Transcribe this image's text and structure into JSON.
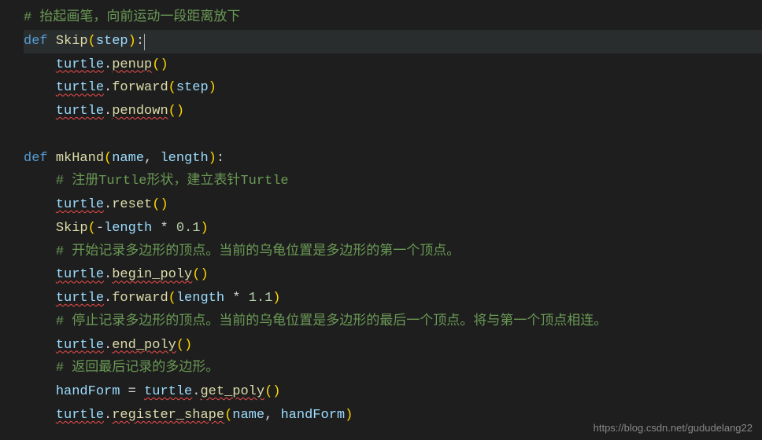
{
  "lines": {
    "l1": "# 抬起画笔，向前运动一段距离放下",
    "l2_def": "def ",
    "l2_func": "Skip",
    "l2_paren_open": "(",
    "l2_param": "step",
    "l2_paren_close": ")",
    "l2_colon": ":",
    "l3_indent": "    ",
    "l3_obj": "turtle",
    "l3_dot": ".",
    "l3_method": "penup",
    "l3_parens": "()",
    "l4_indent": "    ",
    "l4_obj": "turtle",
    "l4_dot": ".",
    "l4_method": "forward",
    "l4_paren_open": "(",
    "l4_arg": "step",
    "l4_paren_close": ")",
    "l5_indent": "    ",
    "l5_obj": "turtle",
    "l5_dot": ".",
    "l5_method": "pendown",
    "l5_parens": "()",
    "l7_def": "def ",
    "l7_func": "mkHand",
    "l7_paren_open": "(",
    "l7_param1": "name",
    "l7_comma": ", ",
    "l7_param2": "length",
    "l7_paren_close": ")",
    "l7_colon": ":",
    "l8_indent": "    ",
    "l8_comment": "# 注册Turtle形状，建立表针Turtle",
    "l9_indent": "    ",
    "l9_obj": "turtle",
    "l9_dot": ".",
    "l9_method": "reset",
    "l9_parens": "()",
    "l10_indent": "    ",
    "l10_func": "Skip",
    "l10_paren_open": "(",
    "l10_neg": "-",
    "l10_arg": "length",
    "l10_op": " * ",
    "l10_num": "0.1",
    "l10_paren_close": ")",
    "l11_indent": "    ",
    "l11_comment": "# 开始记录多边形的顶点。当前的乌龟位置是多边形的第一个顶点。",
    "l12_indent": "    ",
    "l12_obj": "turtle",
    "l12_dot": ".",
    "l12_method": "begin_poly",
    "l12_parens": "()",
    "l13_indent": "    ",
    "l13_obj": "turtle",
    "l13_dot": ".",
    "l13_method": "forward",
    "l13_paren_open": "(",
    "l13_arg": "length",
    "l13_op": " * ",
    "l13_num": "1.1",
    "l13_paren_close": ")",
    "l14_indent": "    ",
    "l14_comment": "# 停止记录多边形的顶点。当前的乌龟位置是多边形的最后一个顶点。将与第一个顶点相连。",
    "l15_indent": "    ",
    "l15_obj": "turtle",
    "l15_dot": ".",
    "l15_method": "end_poly",
    "l15_parens": "()",
    "l16_indent": "    ",
    "l16_comment": "# 返回最后记录的多边形。",
    "l17_indent": "    ",
    "l17_var": "handForm",
    "l17_eq": " = ",
    "l17_obj": "turtle",
    "l17_dot": ".",
    "l17_method": "get_poly",
    "l17_parens": "()",
    "l18_indent": "    ",
    "l18_obj": "turtle",
    "l18_dot": ".",
    "l18_method": "register_shape",
    "l18_paren_open": "(",
    "l18_arg1": "name",
    "l18_comma": ", ",
    "l18_arg2": "handForm",
    "l18_paren_close": ")"
  },
  "watermark": "https://blog.csdn.net/gududelang22"
}
